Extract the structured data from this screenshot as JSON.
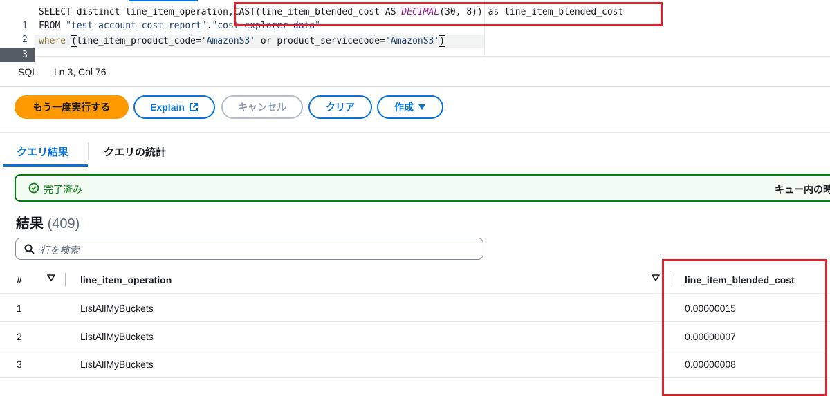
{
  "editor": {
    "lines": [
      {
        "num": "1",
        "parts": [
          "SELECT distinct line_item_operation",
          ",CAST(line_item_blended_cost AS ",
          "DECIMAL",
          "(30, 8)) as line_item_blended_cost"
        ]
      },
      {
        "num": "2",
        "parts": [
          "FROM ",
          "\"test-account-cost-report\"",
          ".",
          "\"cost-explorer-data\""
        ]
      },
      {
        "num": "3",
        "parts": [
          "where ",
          "(",
          "line_item_product_code=",
          "'AmazonS3'",
          " or product_servicecode=",
          "'AmazonS3'",
          ")"
        ]
      }
    ]
  },
  "statusbar": {
    "language": "SQL",
    "position": "Ln 3, Col 76"
  },
  "actions": {
    "rerun": "もう一度実行する",
    "explain": "Explain",
    "cancel": "キャンセル",
    "clear": "クリア",
    "create": "作成"
  },
  "tabs": [
    {
      "label": "クエリ結果",
      "active": true
    },
    {
      "label": "クエリの統計",
      "active": false
    }
  ],
  "banner": {
    "status": "完了済み",
    "queue": "キュー内の時"
  },
  "results": {
    "title": "結果",
    "count": "(409)"
  },
  "search": {
    "placeholder": "行を検索"
  },
  "table": {
    "headers": {
      "index": "#",
      "operation": "line_item_operation",
      "cost": "line_item_blended_cost"
    },
    "rows": [
      {
        "index": "1",
        "operation": "ListAllMyBuckets",
        "cost": "0.00000015"
      },
      {
        "index": "2",
        "operation": "ListAllMyBuckets",
        "cost": "0.00000007"
      },
      {
        "index": "3",
        "operation": "ListAllMyBuckets",
        "cost": "0.00000008"
      }
    ]
  },
  "colors": {
    "accent": "#0972d3",
    "primary": "#ff9900",
    "success": "#037f0c",
    "annotation": "#d9232e"
  }
}
